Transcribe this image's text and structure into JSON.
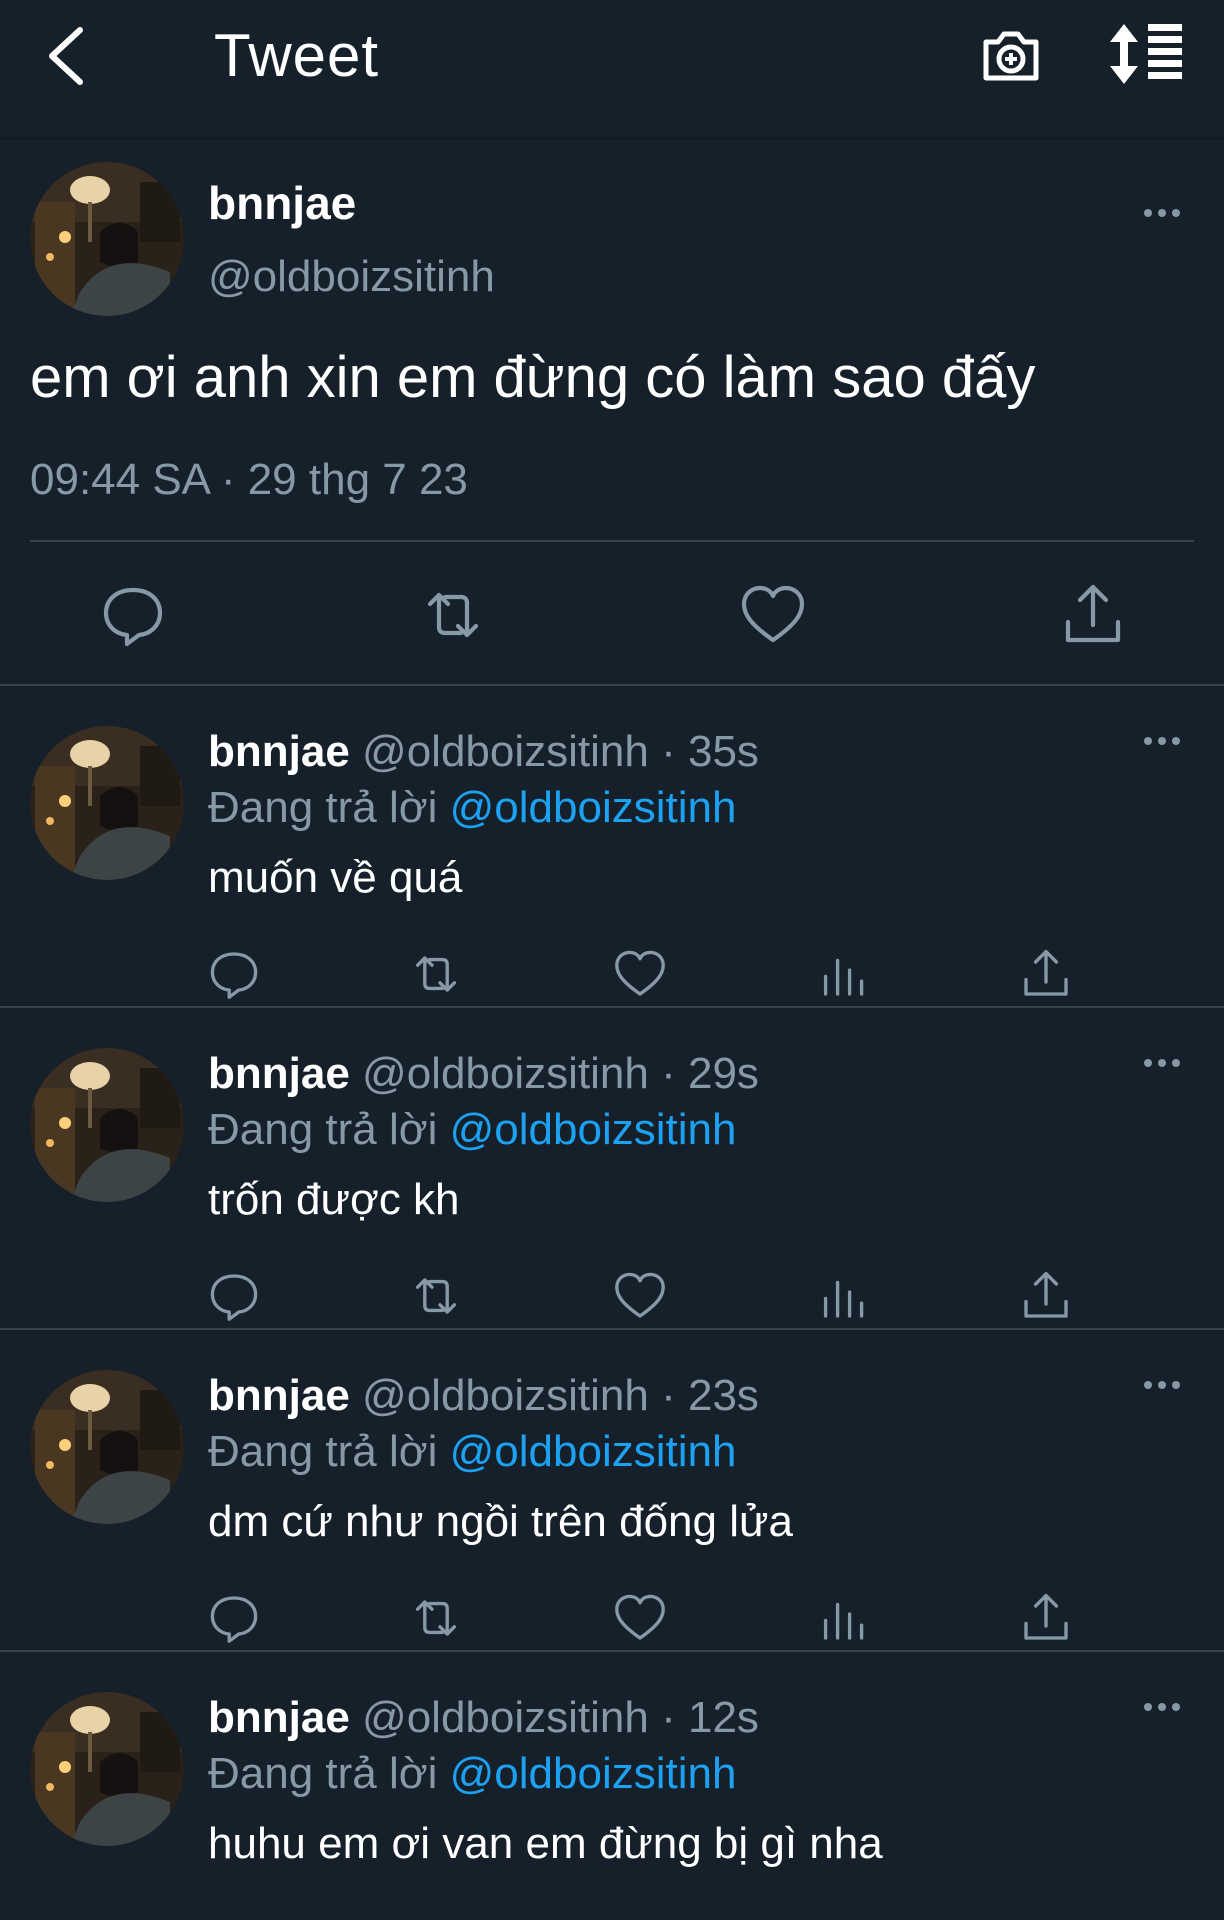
{
  "header": {
    "title": "Tweet",
    "icons": {
      "back": "chevron-left",
      "camera": "camera-plus",
      "sort": "sort-arrows-list"
    }
  },
  "main_tweet": {
    "name": "bnnjae",
    "handle": "@oldboizsitinh",
    "text": "em ơi anh xin em đừng có làm sao đấy",
    "timestamp": "09:44 SA · 29 thg 7 23",
    "actions": [
      "reply-icon",
      "retweet-icon",
      "like-icon",
      "share-icon"
    ]
  },
  "replies": [
    {
      "name": "bnnjae",
      "handle": "@oldboizsitinh",
      "dot": "·",
      "time": "35s",
      "replying_label": "Đang trả lời",
      "replying_to": "@oldboizsitinh",
      "text": "muốn về quá"
    },
    {
      "name": "bnnjae",
      "handle": "@oldboizsitinh",
      "dot": "·",
      "time": "29s",
      "replying_label": "Đang trả lời",
      "replying_to": "@oldboizsitinh",
      "text": "trốn được kh"
    },
    {
      "name": "bnnjae",
      "handle": "@oldboizsitinh",
      "dot": "·",
      "time": "23s",
      "replying_label": "Đang trả lời",
      "replying_to": "@oldboizsitinh",
      "text": "dm cứ như ngồi trên đống lửa"
    },
    {
      "name": "bnnjae",
      "handle": "@oldboizsitinh",
      "dot": "·",
      "time": "12s",
      "replying_label": "Đang trả lời",
      "replying_to": "@oldboizsitinh",
      "text": "huhu em ơi van em đừng bị gì nha"
    }
  ],
  "colors": {
    "background": "#15202b",
    "secondary_text": "#8899a6",
    "link": "#1da1f2",
    "border": "#38444d"
  }
}
